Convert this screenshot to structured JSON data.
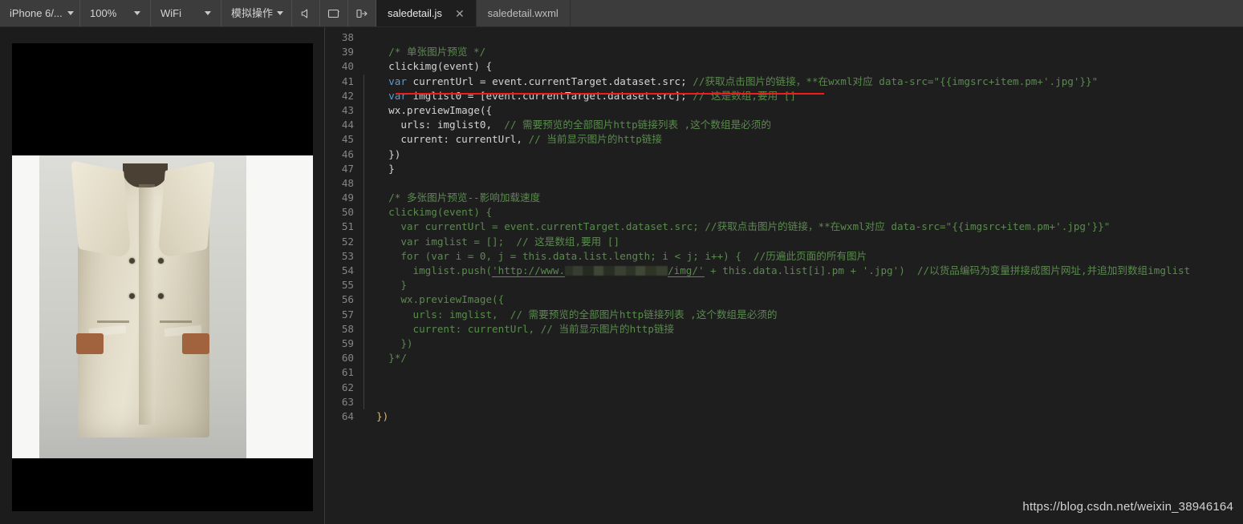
{
  "toolbar": {
    "device_label": "iPhone 6/...",
    "zoom_label": "100%",
    "network_label": "WiFi",
    "simulate_label": "模拟操作",
    "icons": {
      "speaker": "speaker-icon",
      "screen": "screen-icon",
      "detach": "detach-panel-icon"
    }
  },
  "tabs": [
    {
      "label": "saledetail.js",
      "active": true,
      "close": "✕"
    },
    {
      "label": "saledetail.wxml",
      "active": false,
      "close": ""
    }
  ],
  "simulator": {
    "name": "image-preview",
    "description": "全屏图片预览 - 米色风衣外套"
  },
  "editor": {
    "language": "javascript",
    "first_line": 38,
    "lines": [
      {
        "n": 38,
        "text": ""
      },
      {
        "n": 39,
        "text": "  /* 单张图片预览 */"
      },
      {
        "n": 40,
        "text": "  clickimg(event) {"
      },
      {
        "n": 41,
        "text": "    var currentUrl = event.currentTarget.dataset.src; //获取点击图片的链接，**在wxml对应 data-src=\"{{imgsrc+item.pm+'.jpg'}}\""
      },
      {
        "n": 42,
        "text": "    var imglist0 = [event.currentTarget.dataset.src]; // 这是数组,要用 []"
      },
      {
        "n": 43,
        "text": "    wx.previewImage({"
      },
      {
        "n": 44,
        "text": "      urls: imglist0,  // 需要预览的全部图片http链接列表 ,这个数组是必须的"
      },
      {
        "n": 45,
        "text": "      current: currentUrl, // 当前显示图片的http链接"
      },
      {
        "n": 46,
        "text": "    })"
      },
      {
        "n": 47,
        "text": "  }"
      },
      {
        "n": 48,
        "text": ""
      },
      {
        "n": 49,
        "text": "  /* 多张图片预览--影响加载速度"
      },
      {
        "n": 50,
        "text": "  clickimg(event) {"
      },
      {
        "n": 51,
        "text": "    var currentUrl = event.currentTarget.dataset.src; //获取点击图片的链接，**在wxml对应 data-src=\"{{imgsrc+item.pm+'.jpg'}}\""
      },
      {
        "n": 52,
        "text": "    var imglist = [];  // 这是数组,要用 []"
      },
      {
        "n": 53,
        "text": "    for (var i = 0, j = this.data.list.length; i < j; i++) {  //历遍此页面的所有图片"
      },
      {
        "n": 54,
        "text": "      imglist.push('http://www.[REDACTED]/img/' + this.data.list[i].pm + '.jpg')  //以货品编码为变量拼接成图片网址,并追加到数组imglist"
      },
      {
        "n": 55,
        "text": "    }"
      },
      {
        "n": 56,
        "text": "    wx.previewImage({"
      },
      {
        "n": 57,
        "text": "      urls: imglist,  // 需要预览的全部图片http链接列表 ,这个数组是必须的"
      },
      {
        "n": 58,
        "text": "      current: currentUrl, // 当前显示图片的http链接"
      },
      {
        "n": 59,
        "text": "    })"
      },
      {
        "n": 60,
        "text": "  }*/"
      },
      {
        "n": 61,
        "text": ""
      },
      {
        "n": 62,
        "text": ""
      },
      {
        "n": 63,
        "text": ""
      },
      {
        "n": 64,
        "text": "})"
      }
    ],
    "annotation": {
      "type": "red-underline",
      "on_line": 42,
      "color": "#f01d1d"
    }
  },
  "watermark": {
    "text": "https://blog.csdn.net/weixin_38946164"
  },
  "colors": {
    "editor_bg": "#1e1e1e",
    "toolbar_bg": "#3c3c3c",
    "comment": "#5a8a4e",
    "keyword": "#569cd6",
    "string": "#ce9178",
    "accent_red": "#f01d1d"
  }
}
